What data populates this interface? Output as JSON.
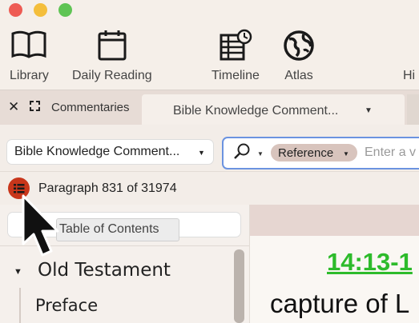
{
  "toolbar": {
    "items": [
      {
        "label": "Library",
        "icon": "library-book-icon"
      },
      {
        "label": "Daily Reading",
        "icon": "calendar-icon"
      },
      {
        "label": "Timeline",
        "icon": "timeline-icon"
      },
      {
        "label": "Atlas",
        "icon": "globe-icon"
      },
      {
        "label": "Hi",
        "icon": ""
      }
    ]
  },
  "tabs": {
    "panel_name": "Commentaries",
    "active_tab_label": "Bible Knowledge Comment..."
  },
  "resource": {
    "selected": "Bible Knowledge Comment..."
  },
  "search": {
    "scope": "Reference",
    "placeholder": "Enter a v"
  },
  "paragraph": {
    "text": "Paragraph 831 of 31974"
  },
  "toc": {
    "tooltip": "Table of Contents",
    "items": [
      {
        "label": "Old Testament",
        "expanded": true
      },
      {
        "label": "Preface"
      }
    ]
  },
  "content": {
    "heading": "14:13-1",
    "body": "capture of L"
  },
  "colors": {
    "accent_blue": "#6b93e0",
    "toc_button": "#c8361b",
    "heading_green": "#2dbb2b"
  }
}
